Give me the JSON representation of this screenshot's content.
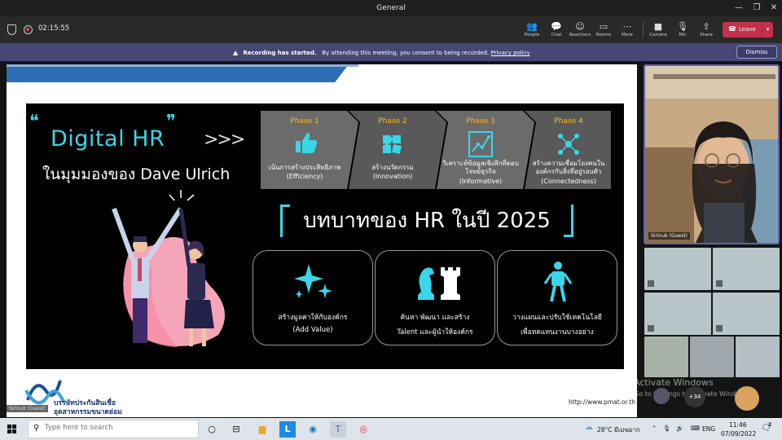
{
  "window": {
    "title": "General"
  },
  "toolbar": {
    "timer": "02:15:55",
    "people": "People",
    "chat": "Chat",
    "reactions": "Reactions",
    "rooms": "Rooms",
    "more": "More",
    "camera": "Camera",
    "mic": "Mic",
    "share": "Share",
    "leave": "Leave"
  },
  "banner": {
    "title": "Recording has started.",
    "text": "By attending this meeting, you consent to being recorded.",
    "link": "Privacy policy",
    "dismiss": "Dismiss"
  },
  "slide": {
    "digital_hr": "Digital HR",
    "subtitle": "ในมุมมองของ Dave Ulrich",
    "arrows": ">>>",
    "phases": [
      {
        "title": "Phase  1",
        "line1": "เน้นการสร้างประสิทธิภาพ",
        "line2": "(Efficiency)",
        "icon": "thumbs-up-icon"
      },
      {
        "title": "Phase  2",
        "line1": "สร้างนวัตกรรม",
        "line2": "(Innovation)",
        "icon": "puzzle-icon"
      },
      {
        "title": "Phase  3",
        "line1": "วิเคราะห์ข้อมูลเชิงลึกที่ตอบโจทย์ธุรกิจ",
        "line2": "(Informative)",
        "icon": "chart-icon"
      },
      {
        "title": "Phase  4",
        "line1": "สร้างความเชื่อมโยงคนในองค์กรกับสิ่งที่อยู่รอบตัว",
        "line2": "(Connectedness)",
        "icon": "network-icon"
      }
    ],
    "role_title": "บทบาทของ HR ในปี 2025",
    "roles": [
      {
        "l1": "สร้างมูลค่าให้กับองค์กร",
        "l2": "(Add Value)",
        "icon": "sparkle-icon"
      },
      {
        "l1": "ค้นหา พัฒนา และสร้าง",
        "l2": "Talent และผู้นำให้องค์กร",
        "icon": "chess-icon"
      },
      {
        "l1": "วางแผนและปรับใช้เทคโนโลยี",
        "l2": "เพื่อทดแทนงานบางอย่าง",
        "icon": "robot-icon"
      }
    ],
    "logo_line1": "บรรษัทประกันสินเชื่อ",
    "logo_line2": "อุตสาหกรรมขนาดย่อม",
    "url": "http://www.pmat.or.th",
    "presenter_overlay": "Sirinuk (Guest)"
  },
  "speaker": {
    "name": "Sirinuk (Guest)"
  },
  "gallery": {
    "more_count": "+34",
    "watermark1": "Activate Windows",
    "watermark2": "Go to Settings to activate Windows."
  },
  "taskbar": {
    "search_placeholder": "Type here to search",
    "weather": "28°C  มีเมฆมาก",
    "lang": "ENG",
    "time": "11:46",
    "date": "07/09/2022",
    "notif": "2"
  },
  "colors": {
    "accent": "#6264a7",
    "leave": "#c4314b",
    "cyan": "#3ad6e8",
    "phase_title": "#ffb81c"
  }
}
